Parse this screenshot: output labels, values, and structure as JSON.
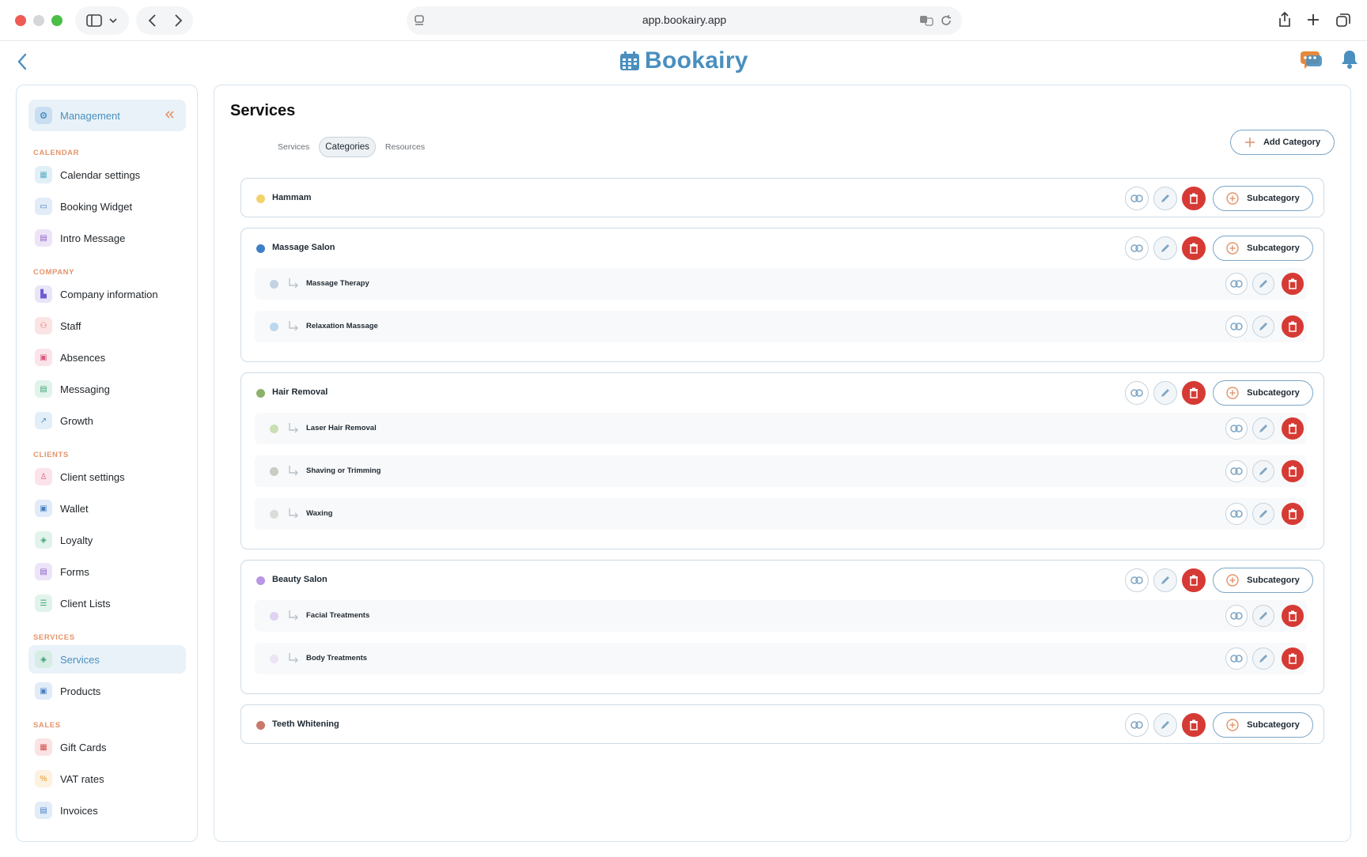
{
  "browser": {
    "url": "app.bookairy.app"
  },
  "app": {
    "logo_text": "Bookairy"
  },
  "sidebar": {
    "management_label": "Management",
    "sections": [
      {
        "label": "CALENDAR"
      },
      {
        "label": "COMPANY"
      },
      {
        "label": "CLIENTS"
      },
      {
        "label": "SERVICES"
      },
      {
        "label": "SALES"
      }
    ],
    "items": [
      {
        "label": "Calendar settings",
        "icon": "calendar-settings-icon"
      },
      {
        "label": "Booking Widget",
        "icon": "widget-icon"
      },
      {
        "label": "Intro Message",
        "icon": "message-icon"
      },
      {
        "label": "Company information",
        "icon": "building-icon"
      },
      {
        "label": "Staff",
        "icon": "people-icon"
      },
      {
        "label": "Absences",
        "icon": "calendar-off-icon"
      },
      {
        "label": "Messaging",
        "icon": "chat-icon"
      },
      {
        "label": "Growth",
        "icon": "trend-icon"
      },
      {
        "label": "Client settings",
        "icon": "user-icon"
      },
      {
        "label": "Wallet",
        "icon": "wallet-icon"
      },
      {
        "label": "Loyalty",
        "icon": "tag-icon"
      },
      {
        "label": "Forms",
        "icon": "form-icon"
      },
      {
        "label": "Client Lists",
        "icon": "list-icon"
      },
      {
        "label": "Services",
        "icon": "services-tag-icon"
      },
      {
        "label": "Products",
        "icon": "box-icon"
      },
      {
        "label": "Gift Cards",
        "icon": "gift-icon"
      },
      {
        "label": "VAT rates",
        "icon": "percent-icon"
      },
      {
        "label": "Invoices",
        "icon": "invoice-icon"
      }
    ]
  },
  "main": {
    "title": "Services",
    "tabs": [
      {
        "label": "Services"
      },
      {
        "label": "Categories"
      },
      {
        "label": "Resources"
      }
    ],
    "add_category_label": "Add Category",
    "subcategory_label": "Subcategory",
    "categories": [
      {
        "name": "Hammam",
        "color": "#f2d36b",
        "subcategories": []
      },
      {
        "name": "Massage Salon",
        "color": "#3f7fc6",
        "subcategories": [
          {
            "name": "Massage Therapy",
            "color": "#c3d2e4"
          },
          {
            "name": "Relaxation Massage",
            "color": "#bcd8f0"
          }
        ]
      },
      {
        "name": "Hair Removal",
        "color": "#8cb16a",
        "subcategories": [
          {
            "name": "Laser Hair Removal",
            "color": "#c9dfb4"
          },
          {
            "name": "Shaving or Trimming",
            "color": "#c9cbc4"
          },
          {
            "name": "Waxing",
            "color": "#dcdcd6"
          }
        ]
      },
      {
        "name": "Beauty Salon",
        "color": "#b996e6",
        "subcategories": [
          {
            "name": "Facial Treatments",
            "color": "#e0d2f2"
          },
          {
            "name": "Body Treatments",
            "color": "#ece4f5"
          }
        ]
      },
      {
        "name": "Teeth Whitening",
        "color": "#c9786a",
        "subcategories": []
      }
    ]
  }
}
